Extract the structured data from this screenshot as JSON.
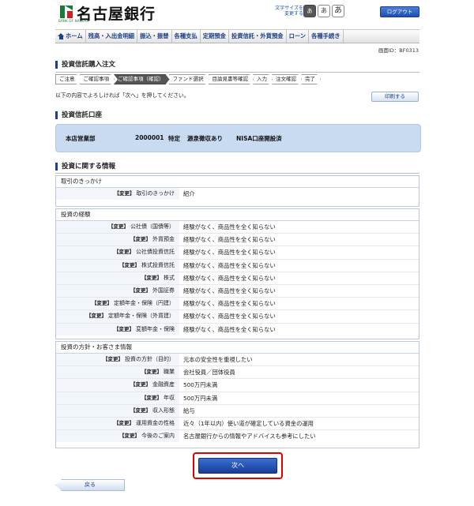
{
  "header": {
    "logo_sub": "BANK OF NAGOYA",
    "bank_name": "名古屋銀行",
    "fontsize_label": "文字サイズを 変更する",
    "fontsize_buttons": [
      "あ",
      "あ",
      "あ"
    ],
    "logout": "ログアウト"
  },
  "nav": {
    "items": [
      "ホーム",
      "残高・入出金明細",
      "振込・振替",
      "各種支払",
      "定期預金",
      "投資信託・外貨預金",
      "ローン",
      "各種手続き"
    ],
    "active_index": 5
  },
  "screen_id": "画面ID：BF0313",
  "page_title": "投資信託購入注文",
  "steps": [
    "ご注意",
    "ご確認事項",
    "ご確認事項（確認）",
    "ファンド選択",
    "目論見書等確認",
    "入力",
    "注文確認",
    "完了"
  ],
  "current_step_index": 2,
  "instruction": "以下の内容でよろしければ「次へ」を押してください。",
  "print_button": "印刷する",
  "account": {
    "title": "投資信託口座",
    "branch": "本店営業部",
    "number": "2000001",
    "type": "特定",
    "withholding": "源泉徴収あり",
    "nisa": "NISA口座開設済"
  },
  "info": {
    "title": "投資に関する情報",
    "panels": [
      {
        "heading": "取引のきっかけ",
        "rows": [
          {
            "tag": "【変更】",
            "label": "取引のきっかけ",
            "value": "紹介"
          }
        ]
      },
      {
        "heading": "投資の経験",
        "rows": [
          {
            "tag": "【変更】",
            "label": "公社債（国債等）",
            "value": "経験がなく、商品性を全く知らない"
          },
          {
            "tag": "【変更】",
            "label": "外貨預金",
            "value": "経験がなく、商品性を全く知らない"
          },
          {
            "tag": "【変更】",
            "label": "公社債投資信託",
            "value": "経験がなく、商品性を全く知らない"
          },
          {
            "tag": "【変更】",
            "label": "株式投資信託",
            "value": "経験がなく、商品性を全く知らない"
          },
          {
            "tag": "【変更】",
            "label": "株式",
            "value": "経験がなく、商品性を全く知らない"
          },
          {
            "tag": "【変更】",
            "label": "外国証券",
            "value": "経験がなく、商品性を全く知らない"
          },
          {
            "tag": "【変更】",
            "label": "定額年金・保険（円建）",
            "value": "経験がなく、商品性を全く知らない"
          },
          {
            "tag": "【変更】",
            "label": "定額年金・保険（外貨建）",
            "value": "経験がなく、商品性を全く知らない"
          },
          {
            "tag": "【変更】",
            "label": "変額年金・保険",
            "value": "経験がなく、商品性を全く知らない"
          }
        ]
      },
      {
        "heading": "投資の方針・お客さま情報",
        "rows": [
          {
            "tag": "【変更】",
            "label": "投資の方針（目的）",
            "value": "元本の安全性を重視したい"
          },
          {
            "tag": "【変更】",
            "label": "職業",
            "value": "会社役員／団体役員"
          },
          {
            "tag": "【変更】",
            "label": "金融資産",
            "value": "500万円未満"
          },
          {
            "tag": "【変更】",
            "label": "年収",
            "value": "500万円未満"
          },
          {
            "tag": "【変更】",
            "label": "収入形態",
            "value": "給与"
          },
          {
            "tag": "【変更】",
            "label": "運用資金の性格",
            "value": "近々（1年以内）使い道が確定している資金の運用"
          },
          {
            "tag": "【変更】",
            "label": "今後のご案内",
            "value": "名古屋銀行からの情報やアドバイスも参考にしたい"
          }
        ]
      }
    ]
  },
  "next_button": "次へ",
  "back_button": "戻る",
  "colors": {
    "brand_blue": "#1f3f8c",
    "account_bg": "#c9dbf1",
    "highlight_red": "#e00000",
    "logo_green": "#1a7a3a"
  }
}
